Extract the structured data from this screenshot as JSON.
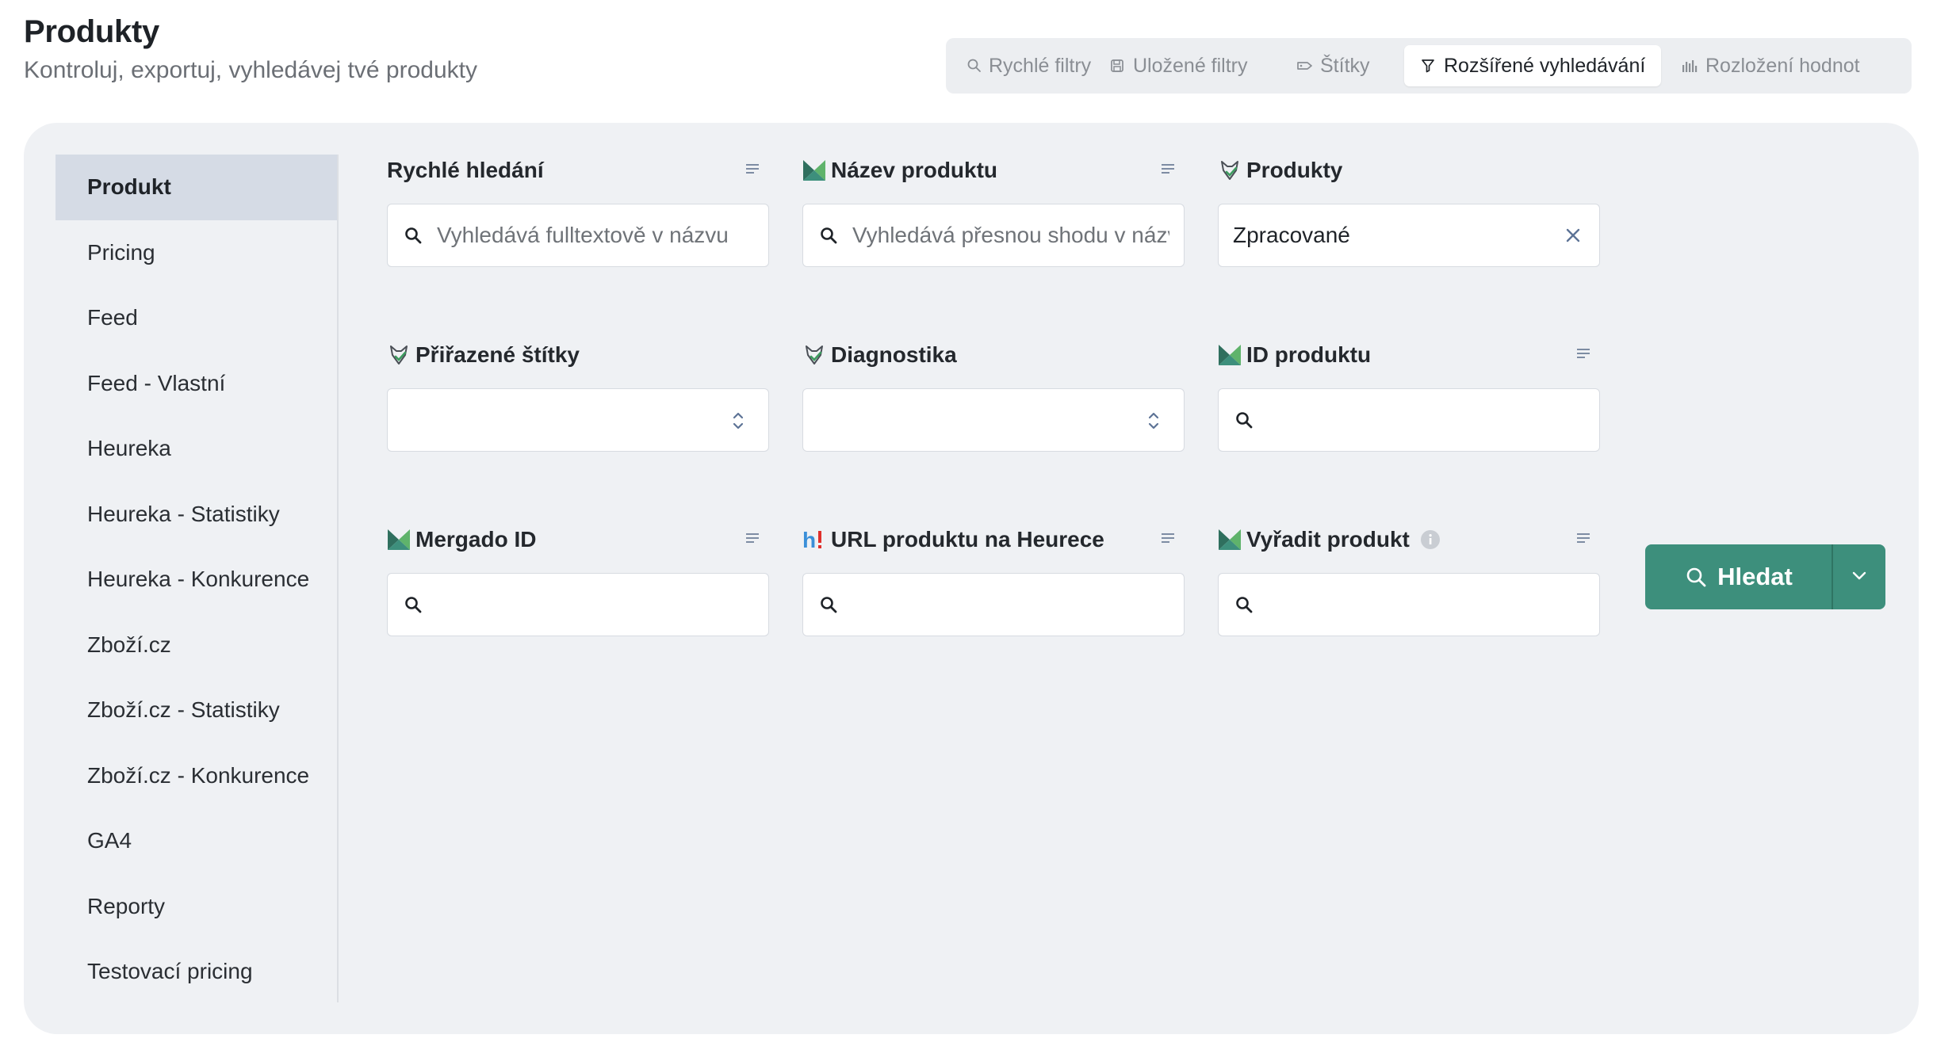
{
  "header": {
    "title": "Produkty",
    "subtitle": "Kontroluj, exportuj, vyhledávej tvé produkty"
  },
  "tabs": [
    {
      "label": "Rychlé filtry",
      "icon": "search-icon"
    },
    {
      "label": "Uložené filtry",
      "icon": "save-icon"
    },
    {
      "label": "Štítky",
      "icon": "tag-icon"
    },
    {
      "label": "Rozšířené vyhledávání",
      "icon": "filter-icon",
      "active": true
    },
    {
      "label": "Rozložení hodnot",
      "icon": "bar-chart-icon"
    }
  ],
  "sidebar": {
    "items": [
      {
        "label": "Produkt",
        "active": true
      },
      {
        "label": "Pricing"
      },
      {
        "label": "Feed"
      },
      {
        "label": "Feed - Vlastní"
      },
      {
        "label": "Heureka"
      },
      {
        "label": "Heureka - Statistiky"
      },
      {
        "label": "Heureka - Konkurence"
      },
      {
        "label": "Zboží.cz"
      },
      {
        "label": "Zboží.cz - Statistiky"
      },
      {
        "label": "Zboží.cz - Konkurence"
      },
      {
        "label": "GA4"
      },
      {
        "label": "Reporty"
      },
      {
        "label": "Testovací pricing"
      }
    ]
  },
  "fields": {
    "quick_search": {
      "label": "Rychlé hledání",
      "placeholder": "Vyhledává fulltextově v názvu",
      "value": ""
    },
    "product_name": {
      "label": "Název produktu",
      "icon": "mergado-logo-icon",
      "placeholder": "Vyhledává přesnou shodu v názvu",
      "value": ""
    },
    "products": {
      "label": "Produkty",
      "icon": "rule-fox-icon",
      "value": "Zpracované"
    },
    "assigned_tags": {
      "label": "Přiřazené štítky",
      "icon": "rule-fox-icon",
      "value": ""
    },
    "diagnostics": {
      "label": "Diagnostika",
      "icon": "rule-fox-icon",
      "value": ""
    },
    "product_id": {
      "label": "ID produktu",
      "icon": "mergado-logo-icon",
      "value": ""
    },
    "mergado_id": {
      "label": "Mergado ID",
      "icon": "mergado-logo-icon",
      "value": ""
    },
    "heureka_url": {
      "label": "URL produktu na Heurece",
      "icon": "heureka-logo-icon",
      "value": ""
    },
    "exclude_product": {
      "label": "Vyřadit produkt",
      "icon": "mergado-logo-icon",
      "value": ""
    }
  },
  "actions": {
    "search_label": "Hledat",
    "accent_color": "#3d8f7c"
  },
  "colors": {
    "panel_bg": "#eff1f4",
    "sidebar_active_bg": "#d5dbe5"
  }
}
